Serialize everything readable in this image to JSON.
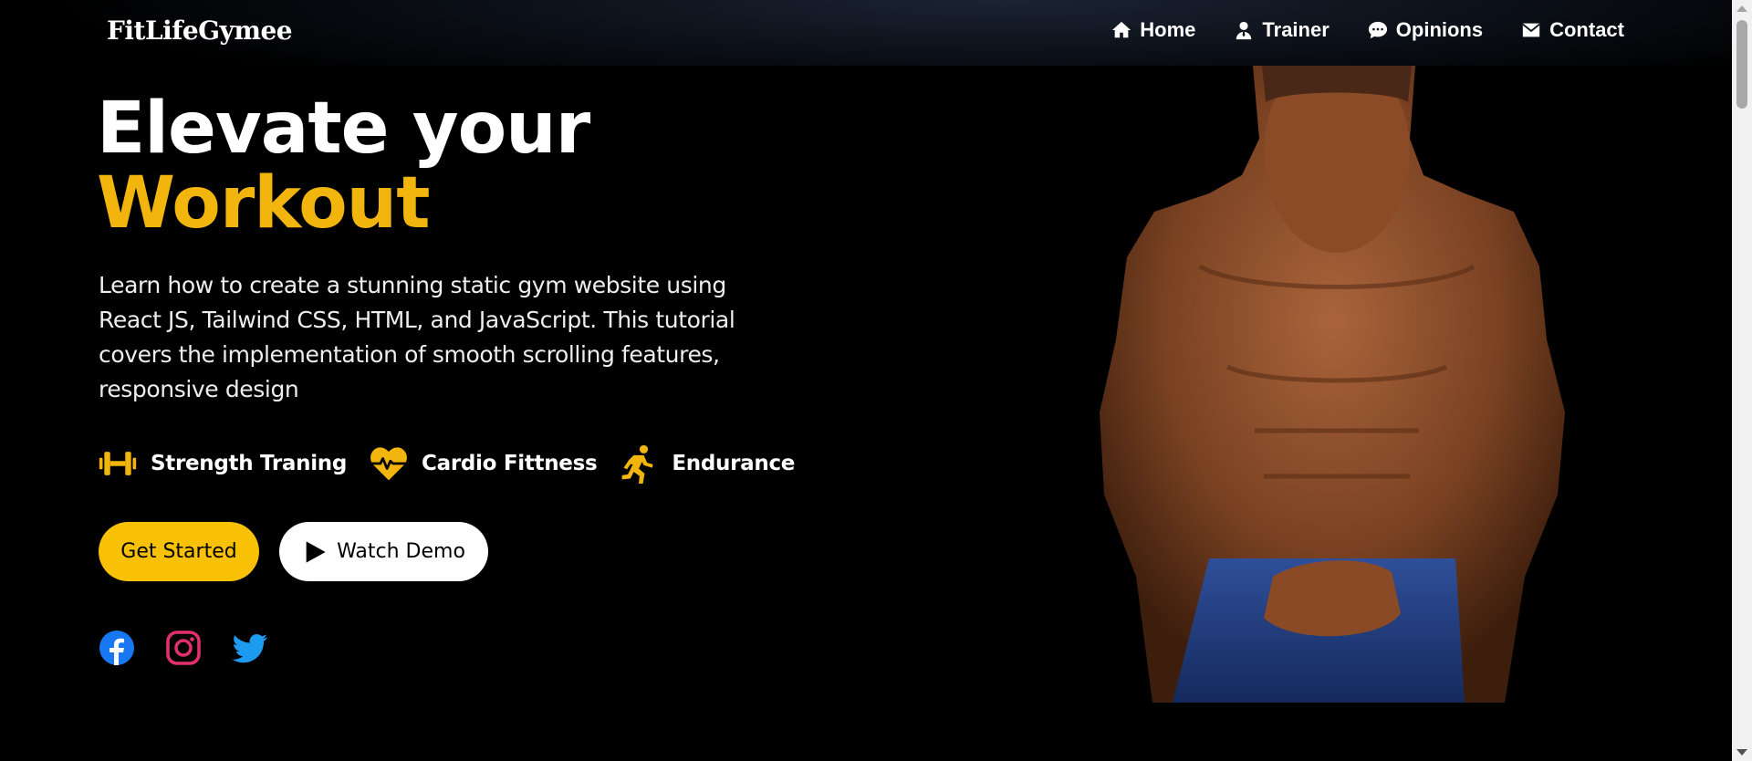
{
  "brand": "FitLifeGymee",
  "nav": [
    {
      "label": "Home",
      "icon": "home-icon"
    },
    {
      "label": "Trainer",
      "icon": "user-icon"
    },
    {
      "label": "Opinions",
      "icon": "comment-icon"
    },
    {
      "label": "Contact",
      "icon": "envelope-icon"
    }
  ],
  "hero": {
    "title_line1": "Elevate your",
    "title_line2": "Workout",
    "description": "Learn how to create a stunning static gym website using React JS, Tailwind CSS, HTML, and JavaScript. This tutorial covers the implementation of smooth scrolling features, responsive design",
    "features": [
      {
        "label": "Strength Traning",
        "icon": "dumbbell-icon"
      },
      {
        "label": "Cardio Fittness",
        "icon": "heartbeat-icon"
      },
      {
        "label": "Endurance",
        "icon": "running-icon"
      }
    ],
    "primary_button": "Get Started",
    "secondary_button": "Watch Demo"
  },
  "socials": [
    "facebook-icon",
    "instagram-icon",
    "twitter-icon"
  ],
  "colors": {
    "accent": "#f2b50d",
    "button": "#f8c106",
    "facebook": "#1877f2",
    "instagram": "#e1306c",
    "twitter": "#1d9bf0"
  }
}
